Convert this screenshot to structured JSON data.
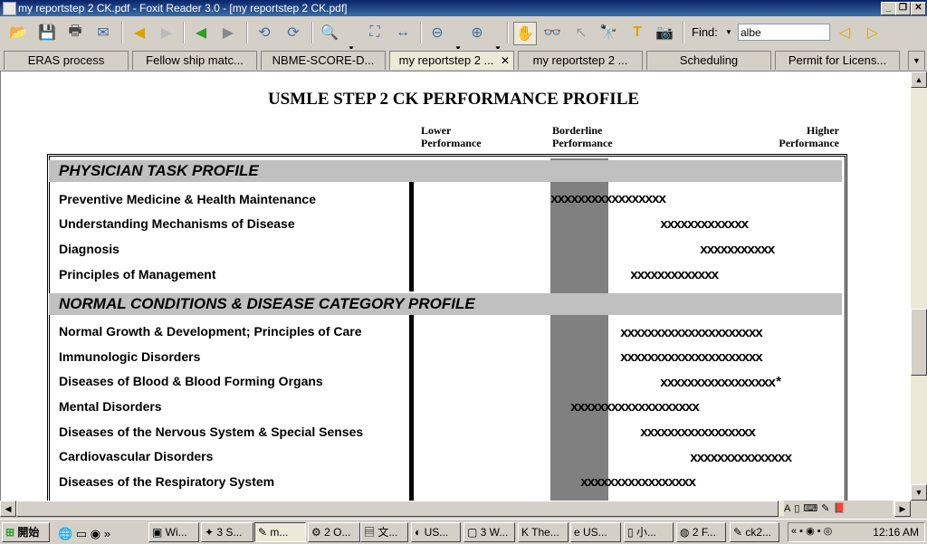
{
  "window": {
    "title": "my reportstep 2 CK.pdf - Foxit Reader 3.0 - [my reportstep 2 CK.pdf]"
  },
  "toolbar": {
    "find_label": "Find:",
    "find_value": "albe"
  },
  "tabs": [
    {
      "label": "ERAS process"
    },
    {
      "label": "Fellow ship matc..."
    },
    {
      "label": "NBME-SCORE-D..."
    },
    {
      "label": "my reportstep 2 ...",
      "active": true
    },
    {
      "label": "my reportstep 2 ..."
    },
    {
      "label": "Scheduling"
    },
    {
      "label": "Permit for Licens..."
    }
  ],
  "report": {
    "title": "USMLE STEP 2 CK PERFORMANCE PROFILE",
    "headers": {
      "lower_1": "Lower",
      "lower_2": "Performance",
      "borderline_1": "Borderline",
      "borderline_2": "Performance",
      "higher_1": "Higher",
      "higher_2": "Performance"
    },
    "sections": [
      {
        "title": "PHYSICIAN TASK PROFILE",
        "rows": [
          {
            "label": "Preventive Medicine & Health Maintenance",
            "bar": "xxxxxxxxxxxxxxxxx"
          },
          {
            "label": "Understanding Mechanisms of Disease",
            "bar": "xxxxxxxxxxxxx"
          },
          {
            "label": "Diagnosis",
            "bar": "xxxxxxxxxxx"
          },
          {
            "label": "Principles of Management",
            "bar": "xxxxxxxxxxxxx"
          }
        ]
      },
      {
        "title": "NORMAL CONDITIONS & DISEASE CATEGORY PROFILE",
        "rows": [
          {
            "label": "Normal Growth & Development; Principles of Care",
            "bar": "xxxxxxxxxxxxxxxxxxxxx"
          },
          {
            "label": "Immunologic Disorders",
            "bar": "xxxxxxxxxxxxxxxxxxxxx"
          },
          {
            "label": "Diseases of Blood & Blood Forming Organs",
            "bar": "xxxxxxxxxxxxxxxxx*"
          },
          {
            "label": "Mental Disorders",
            "bar": "xxxxxxxxxxxxxxxxxxx"
          },
          {
            "label": "Diseases of the Nervous System & Special Senses",
            "bar": "xxxxxxxxxxxxxxxxx"
          },
          {
            "label": "Cardiovascular Disorders",
            "bar": "xxxxxxxxxxxxxxx"
          },
          {
            "label": "Diseases of the Respiratory System",
            "bar": "xxxxxxxxxxxxxxxxx"
          }
        ]
      }
    ]
  },
  "taskbar": {
    "start": "開始",
    "buttons": [
      "Wi...",
      "3 S...",
      "m...",
      "2 O...",
      "文...",
      "US...",
      "3 W...",
      "The...",
      "US...",
      "小...",
      "2 F...",
      "ck2..."
    ],
    "clock": "12:16 AM"
  }
}
